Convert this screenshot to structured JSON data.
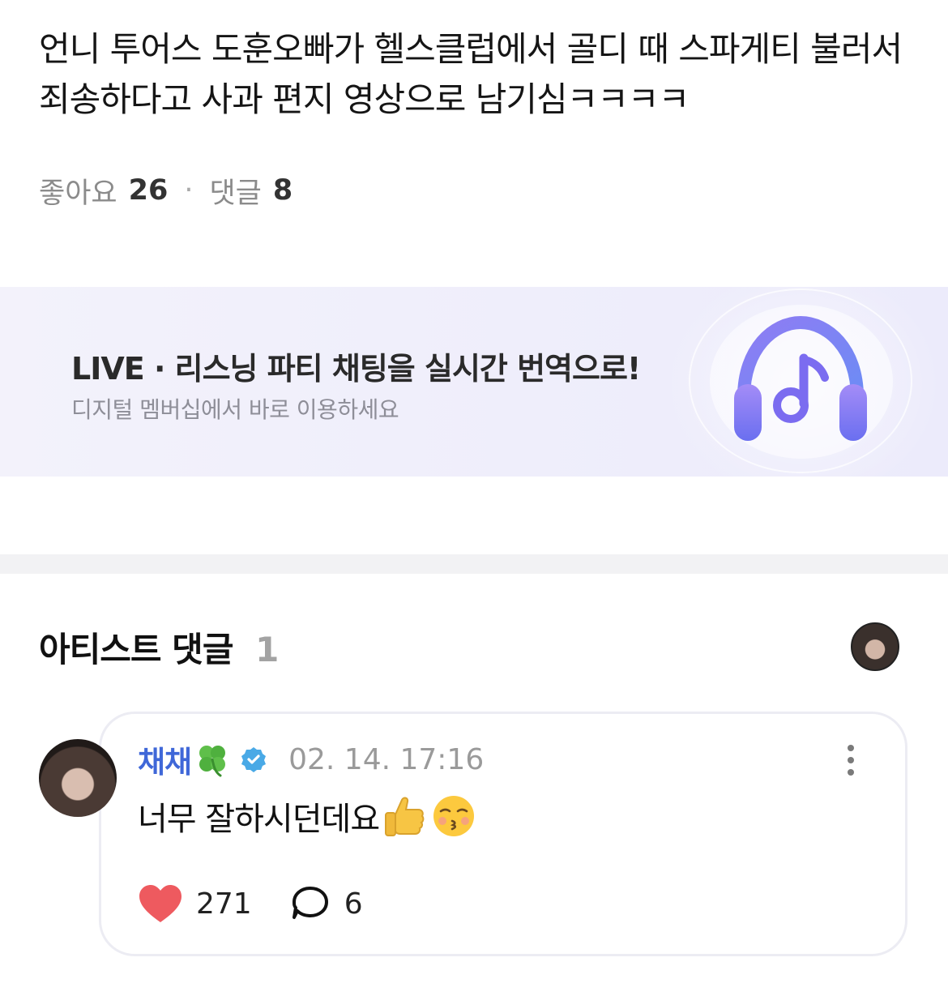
{
  "post": {
    "text": "언니 투어스 도훈오빠가 헬스클럽에서 골디 때 스파게티 불러서 죄송하다고 사과 편지 영상으로 남기심ㅋㅋㅋㅋ",
    "likes_label": "좋아요",
    "likes_count": "26",
    "separator": "·",
    "comments_label": "댓글",
    "comments_count": "8"
  },
  "banner": {
    "title": "LIVE · 리스닝 파티 채팅을 실시간 번역으로!",
    "subtitle": "디지털 멤버십에서 바로 이용하세요",
    "icon": "headphones-music-icon"
  },
  "artist_comments": {
    "title": "아티스트 댓글",
    "count": "1",
    "filter_avatar_icon": "artist-avatar"
  },
  "comment": {
    "author": "채채",
    "author_emoji": "four-leaf-clover",
    "verified_icon": "verified-badge-icon",
    "time": "02. 14. 17:16",
    "text": "너무 잘하시던데요",
    "emojis": [
      "thumbs-up",
      "kissing-face-closed-eyes"
    ],
    "likes": "271",
    "replies": "6",
    "more_icon": "more-vertical-icon"
  },
  "colors": {
    "author": "#3f67d8",
    "heart": "#ee5a5f",
    "verified": "#49a9e6",
    "banner_bg": "#f0effb"
  }
}
